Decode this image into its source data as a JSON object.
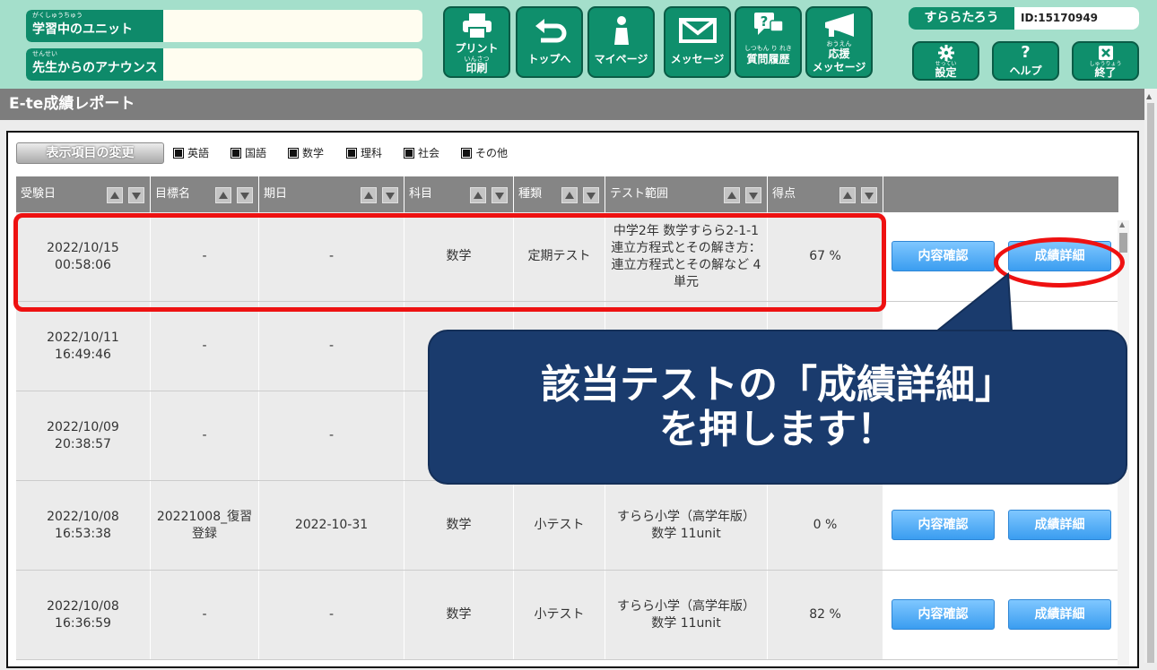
{
  "header": {
    "studying_unit": {
      "ruby": "がくしゅうちゅう",
      "label": "学習中のユニット",
      "value": ""
    },
    "announce": {
      "ruby": "せんせい",
      "label": "先生からのアナウンス",
      "value": ""
    },
    "nav": [
      {
        "ruby": "いんさつ",
        "label1": "プリント",
        "label2": "印刷"
      },
      {
        "label": "トップへ"
      },
      {
        "label": "マイページ"
      },
      {
        "label": "メッセージ"
      },
      {
        "ruby": "しつもん り れき",
        "label": "質問履歴"
      },
      {
        "ruby": "おうえん",
        "label1": "応援",
        "label2": "メッセージ"
      }
    ],
    "user_name": "すららたろう",
    "user_id": "ID:15170949",
    "settings": {
      "ruby": "せってい",
      "label": "設定"
    },
    "help": {
      "label": "ヘルプ"
    },
    "exit": {
      "ruby": "しゅうりょう",
      "label": "終了"
    }
  },
  "page_title": "E-te成績レポート",
  "display_change_button": "表示項目の変更",
  "filters": [
    "英語",
    "国語",
    "数学",
    "理科",
    "社会",
    "その他"
  ],
  "columns": [
    "受験日",
    "目標名",
    "期日",
    "科目",
    "種類",
    "テスト範囲",
    "得点"
  ],
  "rows": [
    {
      "date": "2022/10/15",
      "time": "00:58:06",
      "goal": "-",
      "due": "-",
      "subject": "数学",
      "kind": "定期テスト",
      "range": "中学2年 数学すらら2-1-1 連立方程式とその解き方：連立方程式とその解など 4単元",
      "score": "67 %"
    },
    {
      "date": "2022/10/11",
      "time": "16:49:46",
      "goal": "-",
      "due": "-",
      "subject": "",
      "kind": "",
      "range": "",
      "score": ""
    },
    {
      "date": "2022/10/09",
      "time": "20:38:57",
      "goal": "-",
      "due": "-",
      "subject": "",
      "kind": "",
      "range": "",
      "score": ""
    },
    {
      "date": "2022/10/08",
      "time": "16:53:38",
      "goal": "20221008_復習登録",
      "due": "2022-10-31",
      "subject": "数学",
      "kind": "小テスト",
      "range": "すらら小学（高学年版） 数学 11unit",
      "score": "0 %"
    },
    {
      "date": "2022/10/08",
      "time": "16:36:59",
      "goal": "-",
      "due": "-",
      "subject": "数学",
      "kind": "小テスト",
      "range": "すらら小学（高学年版） 数学 11unit",
      "score": "82 %"
    }
  ],
  "btn_confirm": "内容確認",
  "btn_detail": "成績詳細",
  "callout": {
    "line1": "該当テストの「成績詳細」",
    "line2": "を押します！"
  },
  "colors": {
    "header_bg": "#a4dfcb",
    "nav_green": "#0f8f6c",
    "callout_bg": "#1a3b6d",
    "highlight_red": "#ee1111",
    "action_blue": "#3a9df0"
  }
}
